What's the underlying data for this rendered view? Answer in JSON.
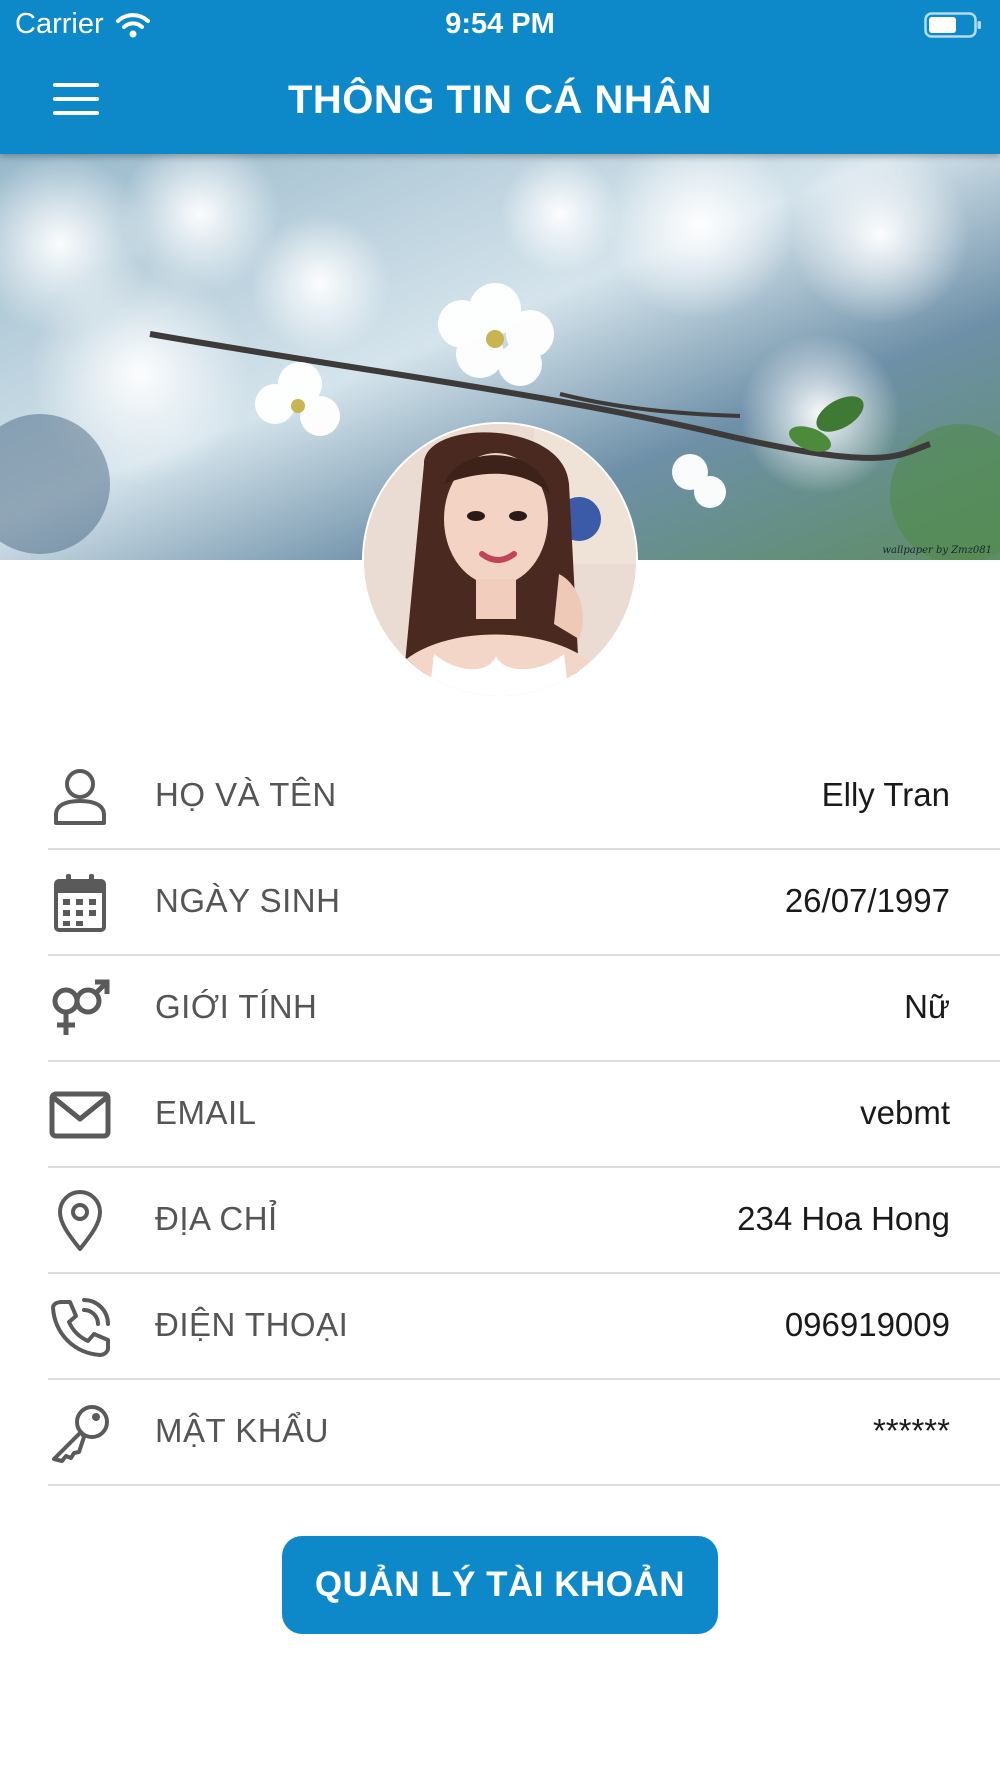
{
  "status_bar": {
    "carrier": "Carrier",
    "time": "9:54 PM"
  },
  "navbar": {
    "title": "THÔNG TIN CÁ NHÂN"
  },
  "cover": {
    "credit": "wallpaper by Zmz081"
  },
  "profile": {
    "rows": [
      {
        "icon": "user-icon",
        "label": "HỌ VÀ TÊN",
        "value": "Elly Tran"
      },
      {
        "icon": "calendar-icon",
        "label": "NGÀY SINH",
        "value": "26/07/1997"
      },
      {
        "icon": "gender-icon",
        "label": "GIỚI TÍNH",
        "value": "Nữ"
      },
      {
        "icon": "mail-icon",
        "label": "EMAIL",
        "value": "vebmt"
      },
      {
        "icon": "location-pin-icon",
        "label": "ĐỊA CHỈ",
        "value": "234 Hoa Hong"
      },
      {
        "icon": "phone-icon",
        "label": "ĐIỆN THOẠI",
        "value": "096919009"
      },
      {
        "icon": "key-icon",
        "label": "MẬT KHẨU",
        "value": "******"
      }
    ]
  },
  "actions": {
    "manage_account": "QUẢN LÝ TÀI KHOẢN"
  },
  "colors": {
    "primary": "#0d88c9",
    "label_text": "#555555",
    "value_text": "#1a1a1a",
    "divider": "#dcdcdc"
  }
}
